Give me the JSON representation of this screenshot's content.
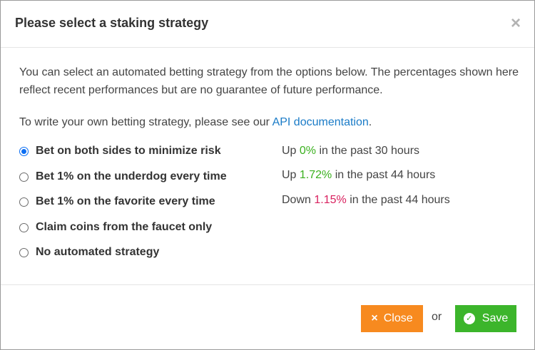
{
  "modal": {
    "title": "Please select a staking strategy",
    "close_symbol": "×"
  },
  "body": {
    "intro": "You can select an automated betting strategy from the options below. The percentages shown here reflect recent performances but are no guarantee of future performance.",
    "note_prefix": "To write your own betting strategy, please see our ",
    "note_link": "API documentation",
    "note_suffix": "."
  },
  "strategies": [
    {
      "label": "Bet on both sides to minimize risk",
      "checked": true,
      "perf": {
        "direction": "Up",
        "value": "0%",
        "suffix": "in the past 30 hours"
      }
    },
    {
      "label": "Bet 1% on the underdog every time",
      "checked": false,
      "perf": {
        "direction": "Up",
        "value": "1.72%",
        "suffix": "in the past 44 hours"
      }
    },
    {
      "label": "Bet 1% on the favorite every time",
      "checked": false,
      "perf": {
        "direction": "Down",
        "value": "1.15%",
        "suffix": "in the past 44 hours"
      }
    },
    {
      "label": "Claim coins from the faucet only",
      "checked": false
    },
    {
      "label": "No automated strategy",
      "checked": false
    }
  ],
  "footer": {
    "close_label": "Close",
    "close_icon": "×",
    "or_text": "or",
    "save_label": "Save",
    "save_icon": "✓"
  },
  "colors": {
    "positive": "#3ab01e",
    "negative": "#d9215f",
    "link": "#1a7bc7",
    "close_button": "#f78a1f",
    "save_button": "#3cb52b",
    "radio_selected": "#0b6ef3"
  }
}
